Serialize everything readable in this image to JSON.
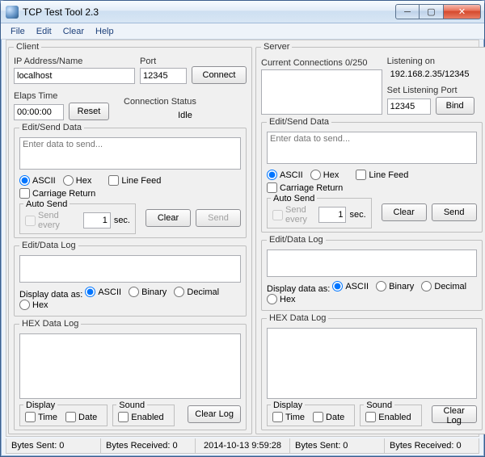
{
  "window": {
    "title": "TCP Test Tool 2.3"
  },
  "menu": {
    "file": "File",
    "edit": "Edit",
    "clear": "Clear",
    "help": "Help"
  },
  "client": {
    "legend": "Client",
    "ip_label": "IP Address/Name",
    "ip_value": "localhost",
    "port_label": "Port",
    "port_value": "12345",
    "connect": "Connect",
    "elapsed_label": "Elaps Time",
    "elapsed_value": "00:00:00",
    "reset": "Reset",
    "conn_status_label": "Connection Status",
    "conn_status_value": "Idle",
    "edit_send_legend": "Edit/Send Data",
    "edit_send_placeholder": "Enter data to send...",
    "ascii": "ASCII",
    "hex": "Hex",
    "linefeed": "Line Feed",
    "cr": "Carriage Return",
    "autosend_legend": "Auto Send",
    "send_every": "Send every",
    "sec": "sec.",
    "autosend_value": "1",
    "clear": "Clear",
    "send": "Send",
    "datalog_legend": "Edit/Data Log",
    "display_as": "Display data as:",
    "binary": "Binary",
    "decimal": "Decimal",
    "hexlog_legend": "HEX Data Log",
    "display_group": "Display",
    "time": "Time",
    "date": "Date",
    "sound_group": "Sound",
    "enabled": "Enabled",
    "clearlog": "Clear Log"
  },
  "server": {
    "legend": "Server",
    "curr_conn_label": "Current Connections 0/250",
    "listening_label": "Listening on",
    "listening_value": "192.168.2.35/12345",
    "set_port_label": "Set Listening Port",
    "set_port_value": "12345",
    "bind": "Bind"
  },
  "status": {
    "bytes_sent_l": "Bytes Sent: 0",
    "bytes_recv_l": "Bytes Received: 0",
    "timestamp": "2014-10-13 9:59:28",
    "bytes_sent_r": "Bytes Sent: 0",
    "bytes_recv_r": "Bytes Received: 0"
  }
}
